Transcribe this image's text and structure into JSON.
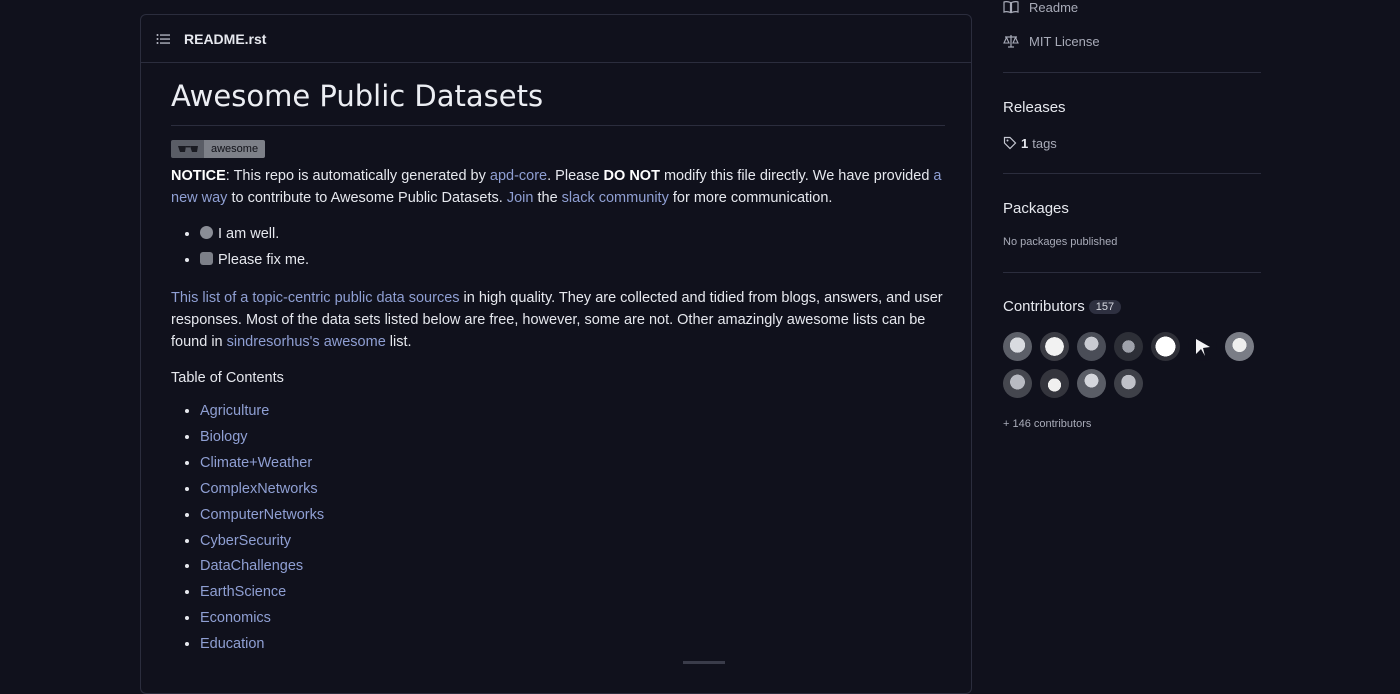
{
  "readme": {
    "filename": "README.rst",
    "title": "Awesome Public Datasets",
    "badge_label": "awesome",
    "notice": {
      "lead": "NOTICE",
      "t1": ": This repo is automatically generated by ",
      "link1": "apd-core",
      "t2": ". Please ",
      "bold": "DO NOT",
      "t3": " modify this file directly. We have provided ",
      "link2": "a new way",
      "t4": " to contribute to Awesome Public Datasets. ",
      "link3": "Join",
      "t5": " the ",
      "link4": "slack community",
      "t6": " for more communication."
    },
    "status_items": [
      {
        "text": "I am well.",
        "icon": "check-badge-icon"
      },
      {
        "text": "Please fix me.",
        "icon": "gear-badge-icon"
      }
    ],
    "intro": {
      "link1": "This list of a topic-centric public data sources",
      "t1": " in high quality. They are collected and tidied from blogs, answers, and user responses. Most of the data sets listed below are free, however, some are not. Other amazingly awesome lists can be found in ",
      "link2": "sindresorhus's awesome",
      "t2": " list."
    },
    "toc_title": "Table of Contents",
    "toc": [
      "Agriculture",
      "Biology",
      "Climate+Weather",
      "ComplexNetworks",
      "ComputerNetworks",
      "CyberSecurity",
      "DataChallenges",
      "EarthScience",
      "Economics",
      "Education"
    ]
  },
  "sidebar": {
    "readme_link": "Readme",
    "license_link": "MIT License",
    "releases": {
      "heading": "Releases",
      "count": "1",
      "label": "tags"
    },
    "packages": {
      "heading": "Packages",
      "empty": "No packages published"
    },
    "contributors": {
      "heading": "Contributors",
      "count": "157",
      "more": "+ 146 contributors"
    }
  },
  "colors": {
    "background": "#10111c",
    "link": "#8f9fd3",
    "border": "#2b2d3d"
  }
}
